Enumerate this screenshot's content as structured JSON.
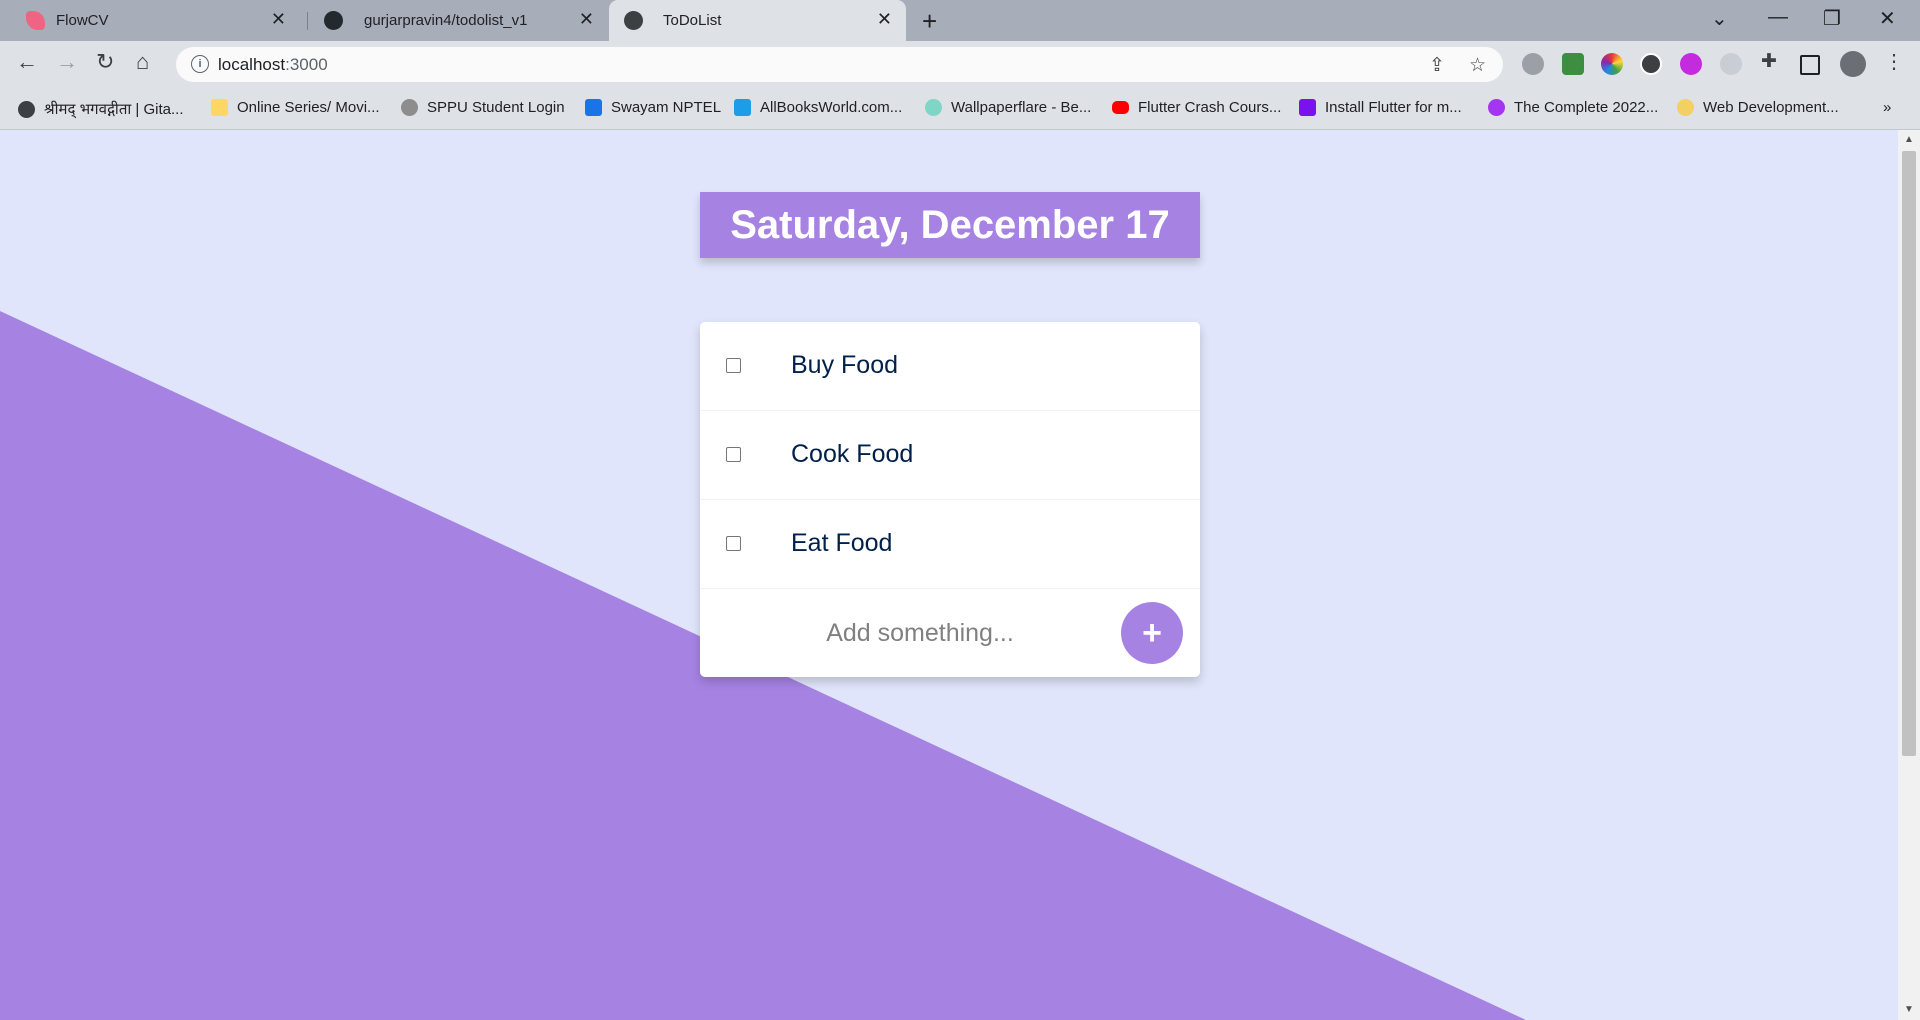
{
  "browser": {
    "tabs": [
      {
        "title": "FlowCV",
        "icon": "flowcv-icon",
        "active": false
      },
      {
        "title": "gurjarpravin4/todolist_v1",
        "icon": "github-icon",
        "active": false
      },
      {
        "title": "ToDoList",
        "icon": "globe-icon",
        "active": true
      }
    ],
    "address": {
      "host": "localhost",
      "port": ":3000"
    },
    "bookmarks": [
      {
        "label": "श्रीमद् भगवद्गीता | Gita...",
        "icon": "globe-icon"
      },
      {
        "label": "Online Series/ Movi...",
        "icon": "folder-icon"
      },
      {
        "label": "SPPU Student Login",
        "icon": "sppu-icon"
      },
      {
        "label": "Swayam NPTEL",
        "icon": "swayam-icon"
      },
      {
        "label": "AllBooksWorld.com...",
        "icon": "book-icon"
      },
      {
        "label": "Wallpaperflare - Be...",
        "icon": "wallpaperflare-icon"
      },
      {
        "label": "Flutter Crash Cours...",
        "icon": "youtube-icon"
      },
      {
        "label": "Install Flutter for m...",
        "icon": "bootstrap-icon"
      },
      {
        "label": "The Complete 2022...",
        "icon": "udemy-icon"
      },
      {
        "label": "Web Development...",
        "icon": "web-dev-icon"
      }
    ],
    "more_bookmarks": "»"
  },
  "app": {
    "date_heading": "Saturday, December 17",
    "items": [
      {
        "text": "Buy Food",
        "checked": false
      },
      {
        "text": "Cook Food",
        "checked": false
      },
      {
        "text": "Eat Food",
        "checked": false
      }
    ],
    "new_item_placeholder": "Add something...",
    "add_button_label": "+"
  },
  "colors": {
    "accent": "#a683e3",
    "background": "#e1e5fb",
    "item_text": "#00204a"
  }
}
